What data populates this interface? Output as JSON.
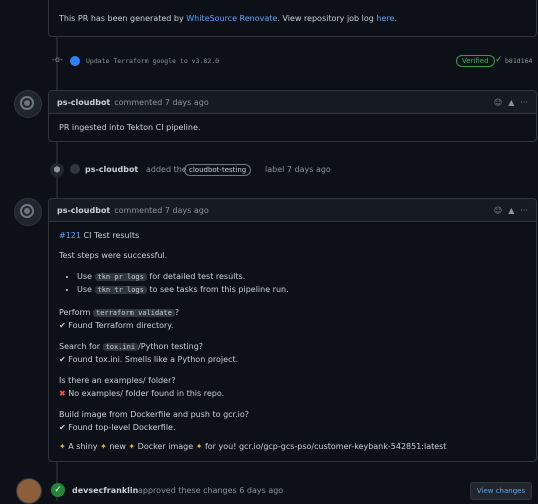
{
  "top_message": {
    "prefix": "This PR has been generated by ",
    "renovate_link": "WhiteSource Renovate",
    "middle": ". View repository job log ",
    "here_link": "here",
    "suffix": "."
  },
  "commit": {
    "message": "Update Terraform google to v3.82.0",
    "verified": "Verified",
    "hash": "b81d164"
  },
  "comment1": {
    "author": "ps-cloudbot",
    "meta": "commented 7 days ago",
    "body": "PR ingested into Tekton CI pipeline."
  },
  "label_event": {
    "author": "ps-cloudbot",
    "added_text": "added the",
    "label": "cloudbot-testing",
    "suffix": "label 7 days ago"
  },
  "comment2": {
    "author": "ps-cloudbot",
    "meta": "commented 7 days ago",
    "issue_link": "#121",
    "title_suffix": "CI Test results",
    "steps_intro": "Test steps were successful.",
    "use1_prefix": "Use",
    "use1_code": "tkn pr logs",
    "use1_suffix": "for detailed test results.",
    "use2_prefix": "Use",
    "use2_code": "tkn tr logs",
    "use2_suffix": "to see tasks from this pipeline run.",
    "perform_prefix": "Perform",
    "perform_code": "terraform validate",
    "perform_suffix": "?",
    "found_terraform": "Found Terraform directory.",
    "search_prefix": "Search for",
    "search_code": "tox.ini",
    "search_suffix": "/Python testing?",
    "found_tox": "Found tox.ini. Smells like a Python project.",
    "examples_q": "Is there an examples/ folder?",
    "no_examples": "No examples/ folder found in this repo.",
    "build_q": "Build image from Dockerfile and push to gcr.io?",
    "found_dockerfile": "Found top-level Dockerfile.",
    "shiny_1": "A shiny",
    "shiny_2": "new",
    "shiny_3": "Docker image",
    "shiny_4": "for you! gcr.io/gcp-gcs-pso/customer-keybank-542851:latest"
  },
  "approval": {
    "author": "devsecfranklin",
    "text": "approved these changes 6 days ago",
    "button": "View changes"
  },
  "icons": [
    "commit-icon",
    "renovate-icon",
    "verified-check-icon",
    "smiley-icon",
    "triangle-icon",
    "ellipsis-icon",
    "tag-icon",
    "check-mark-icon",
    "cross-mark-icon",
    "sparkles-icon",
    "approved-check-icon"
  ],
  "colors": {
    "background": "#0d1117",
    "header": "#161b22",
    "border": "#30363d",
    "link": "#58a6ff",
    "success": "#2ea043",
    "error": "#f85149"
  }
}
